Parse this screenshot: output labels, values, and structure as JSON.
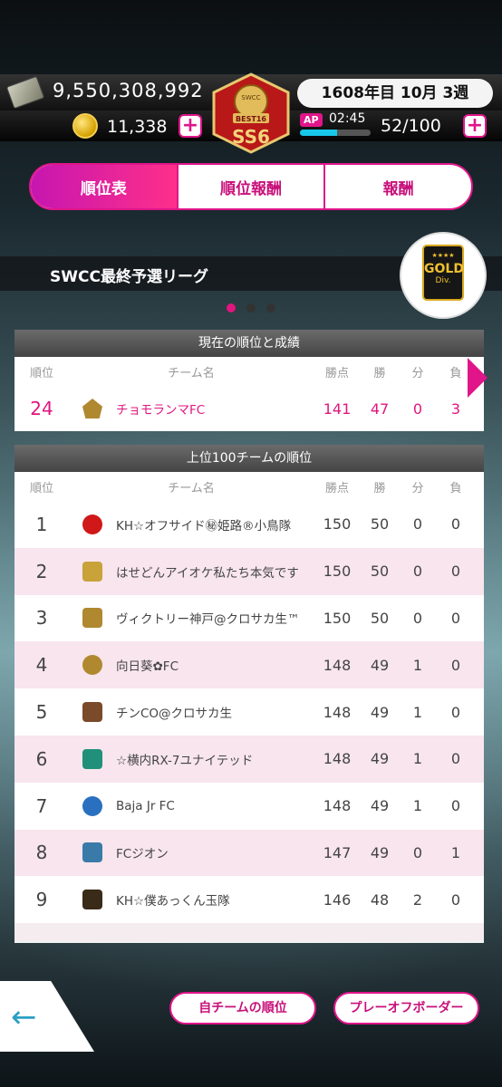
{
  "header": {
    "money": "9,550,308,992",
    "coins": "11,338",
    "date": "1608年目 10月 3週",
    "ap_label": "AP",
    "ap_timer": "02:45",
    "ap_value": "52/100",
    "ap_fill_fraction": 0.52,
    "badge_top": "SWCC",
    "badge_mid": "BEST16",
    "badge_bottom": "SS6"
  },
  "tabs": [
    "順位表",
    "順位報酬",
    "報酬"
  ],
  "league": {
    "title": "SWCC最終予選リーグ",
    "division_stars": "★★★★",
    "division_name": "GOLD",
    "division_sub": "Div."
  },
  "current": {
    "title": "現在の順位と成績",
    "columns": [
      "順位",
      "チーム名",
      "勝点",
      "勝",
      "分",
      "負"
    ],
    "row": {
      "rank": "24",
      "name": "チョモランマFC",
      "pts": "141",
      "w": "47",
      "d": "0",
      "l": "3"
    }
  },
  "top100": {
    "title": "上位100チームの順位",
    "columns": [
      "順位",
      "チーム名",
      "勝点",
      "勝",
      "分",
      "負"
    ],
    "rows": [
      {
        "rank": "1",
        "name": "KH☆オフサイド㊙姫路®小鳥隊",
        "pts": "150",
        "w": "50",
        "d": "0",
        "l": "0",
        "color": "#d01818"
      },
      {
        "rank": "2",
        "name": "はせどんアイオケ私たち本気です",
        "pts": "150",
        "w": "50",
        "d": "0",
        "l": "0",
        "color": "#c9a23a"
      },
      {
        "rank": "3",
        "name": "ヴィクトリー神戸@クロサカ生™",
        "pts": "150",
        "w": "50",
        "d": "0",
        "l": "0",
        "color": "#b08830"
      },
      {
        "rank": "4",
        "name": "向日葵✿FC",
        "pts": "148",
        "w": "49",
        "d": "1",
        "l": "0",
        "color": "#b08830"
      },
      {
        "rank": "5",
        "name": "チンCO@クロサカ生",
        "pts": "148",
        "w": "49",
        "d": "1",
        "l": "0",
        "color": "#7a4a2a"
      },
      {
        "rank": "6",
        "name": "☆横内RX-7ユナイテッド",
        "pts": "148",
        "w": "49",
        "d": "1",
        "l": "0",
        "color": "#20907a"
      },
      {
        "rank": "7",
        "name": "Baja Jr FC",
        "pts": "148",
        "w": "49",
        "d": "1",
        "l": "0",
        "color": "#2a70c0"
      },
      {
        "rank": "8",
        "name": "FCジオン",
        "pts": "147",
        "w": "49",
        "d": "0",
        "l": "1",
        "color": "#3a7aa8"
      },
      {
        "rank": "9",
        "name": "KH☆僕あっくん玉隊",
        "pts": "146",
        "w": "48",
        "d": "2",
        "l": "0",
        "color": "#3a2a18"
      }
    ]
  },
  "buttons": {
    "back": "←",
    "my_rank": "自チームの順位",
    "playoff": "プレーオフボーダー"
  }
}
